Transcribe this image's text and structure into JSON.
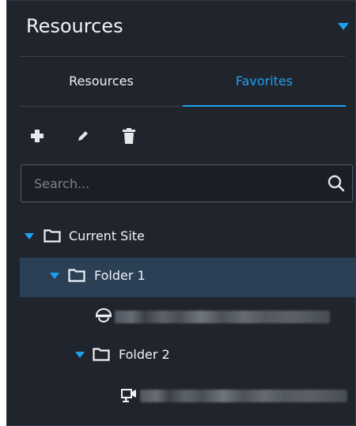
{
  "header": {
    "title": "Resources"
  },
  "tabs": [
    {
      "label": "Resources",
      "active": false
    },
    {
      "label": "Favorites",
      "active": true
    }
  ],
  "toolbar": {
    "icons": [
      "plus-icon",
      "pencil-icon",
      "trash-icon"
    ]
  },
  "search": {
    "placeholder": "Search...",
    "value": ""
  },
  "tree": {
    "site_label": "Current Site",
    "folder1_label": "Folder 1",
    "folder2_label": "Folder 2",
    "device1_icon": "dome-camera-icon",
    "device2_icon": "bullet-camera-icon"
  },
  "colors": {
    "accent": "#1ea0ef",
    "panel_bg": "#20242c",
    "selected_row": "#2b3f55",
    "text": "#f0f2f5"
  }
}
